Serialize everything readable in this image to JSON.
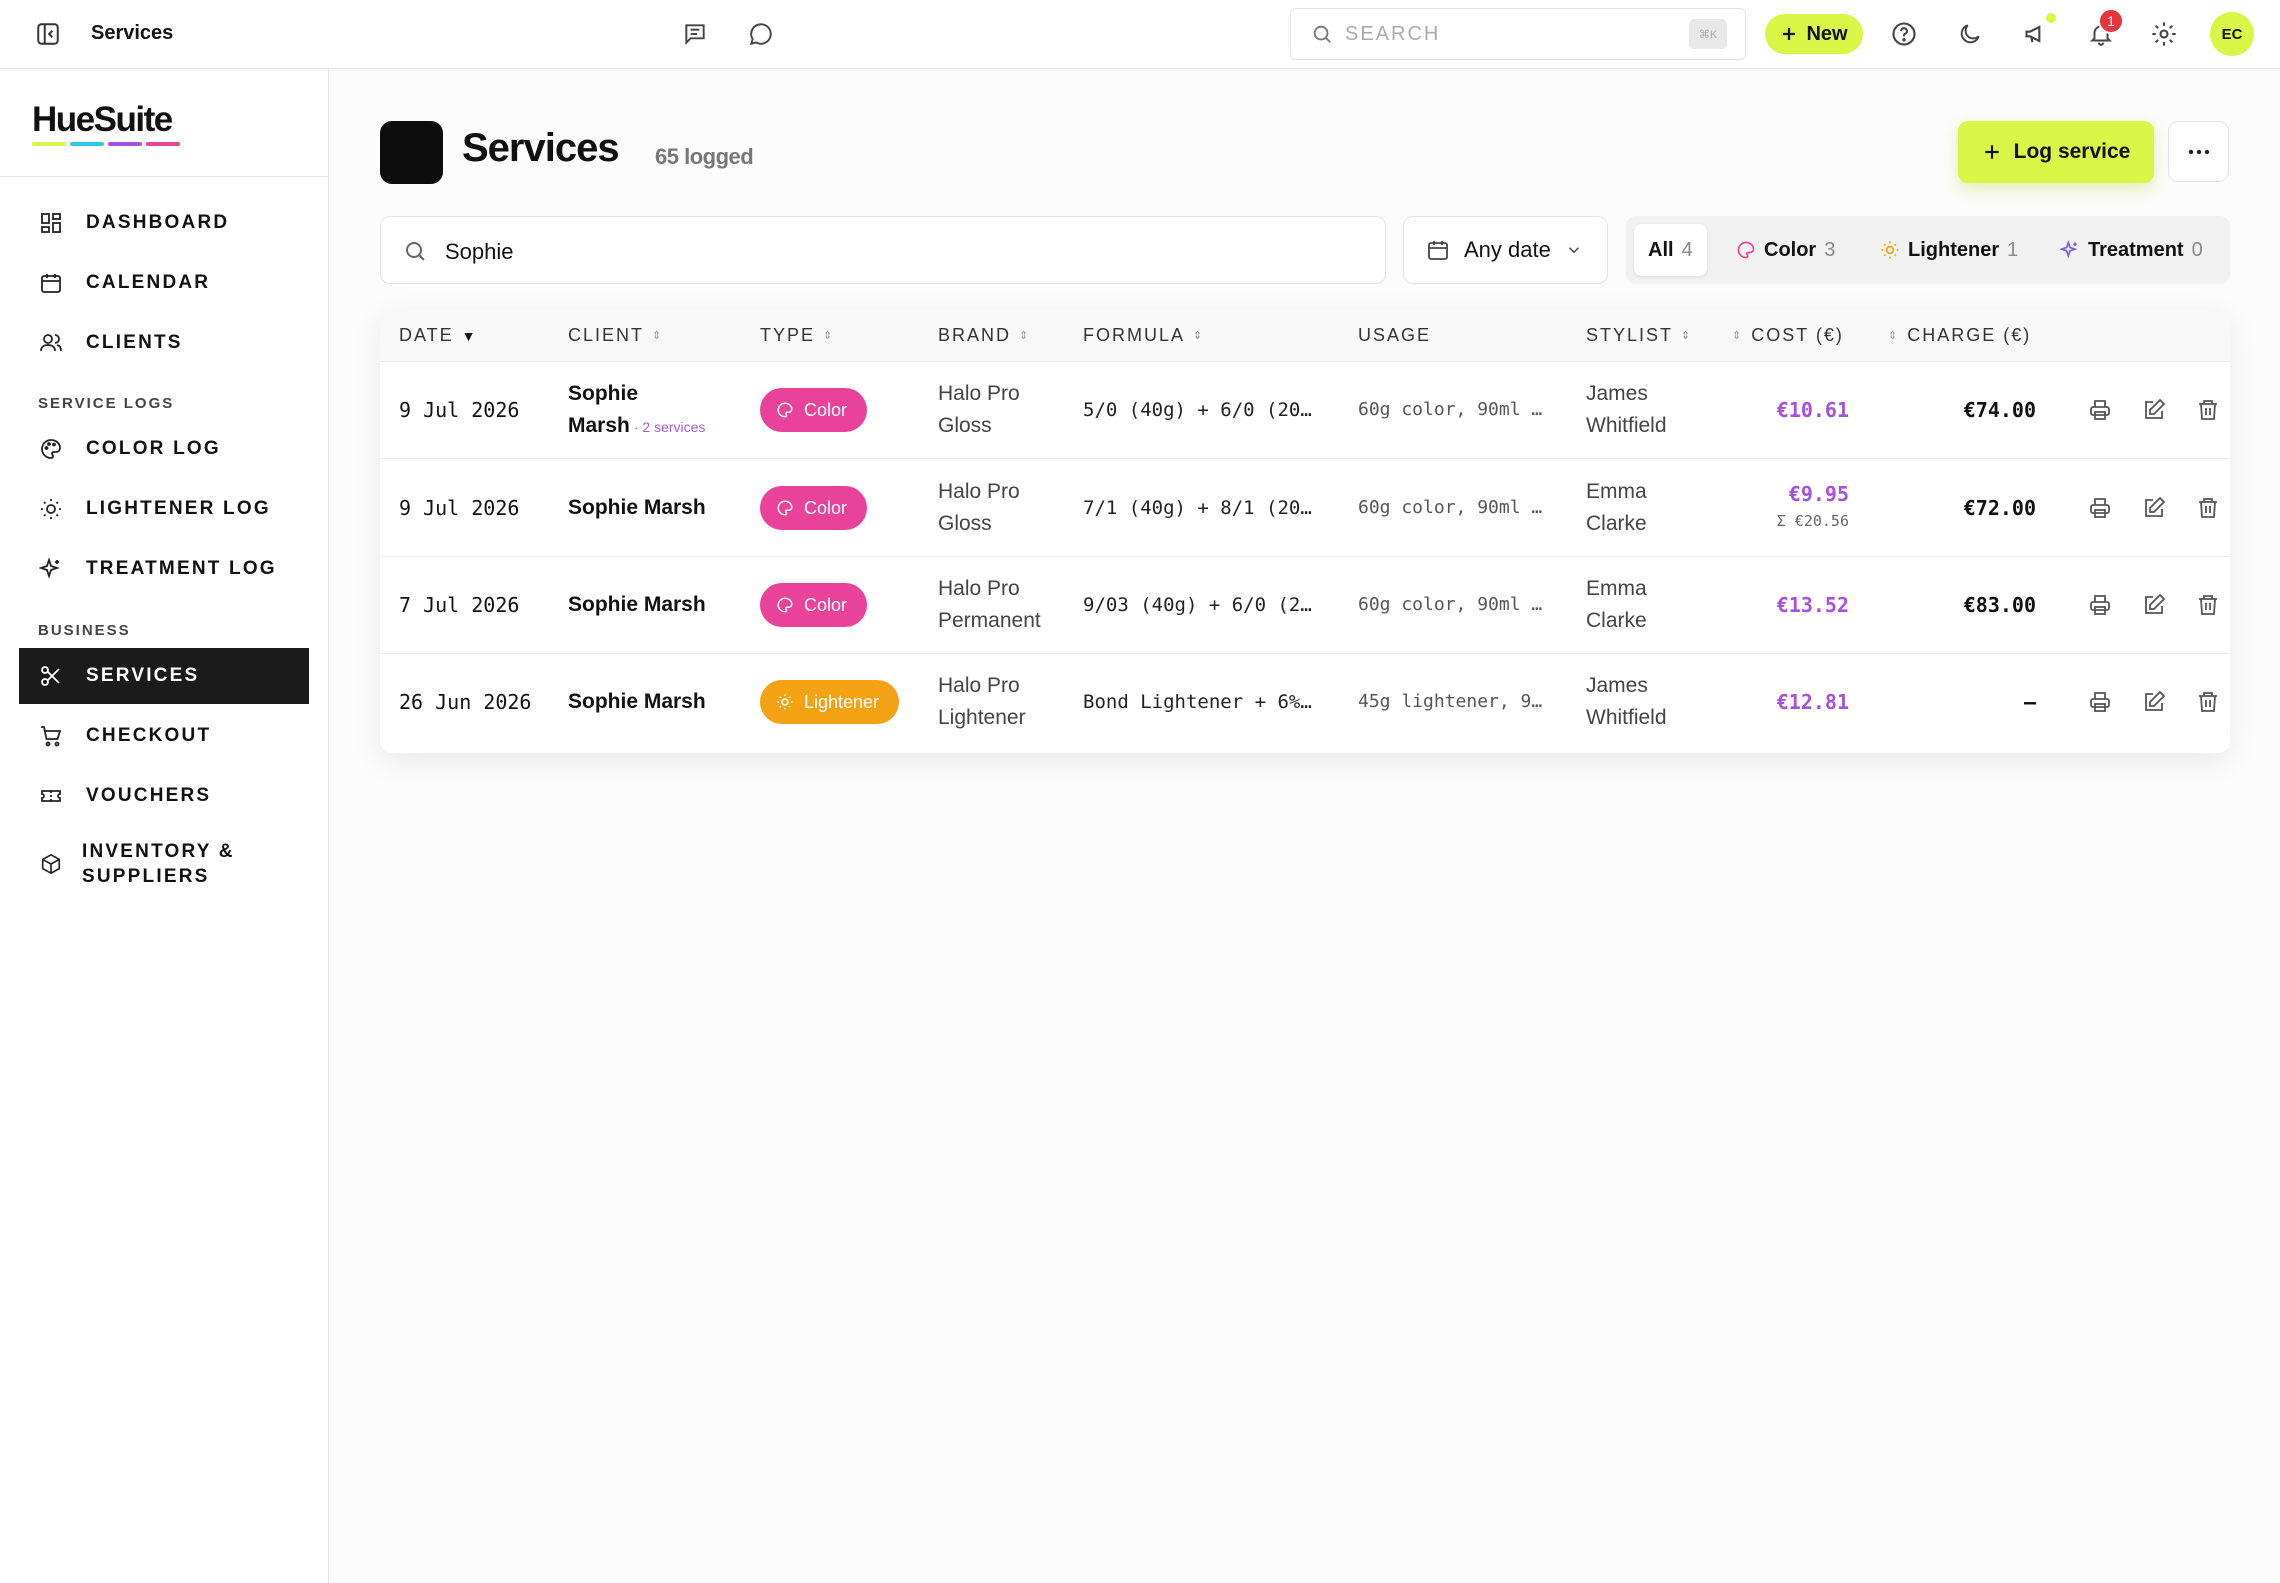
{
  "topbar": {
    "breadcrumb": "Services",
    "search_placeholder": "SEARCH",
    "search_shortcut": "⌘K",
    "new_label": "New",
    "notification_count": "1",
    "avatar_initials": "EC"
  },
  "sidebar": {
    "logo": "HueSuite",
    "logo_colors": [
      "#d9f546",
      "#2fc6e8",
      "#a650e0",
      "#e8429a"
    ],
    "items": [
      {
        "label": "DASHBOARD",
        "icon": "grid-icon"
      },
      {
        "label": "CALENDAR",
        "icon": "calendar-icon"
      },
      {
        "label": "CLIENTS",
        "icon": "users-icon"
      }
    ],
    "section_service_logs": "SERVICE LOGS",
    "log_items": [
      {
        "label": "COLOR LOG",
        "icon": "palette-icon"
      },
      {
        "label": "LIGHTENER LOG",
        "icon": "sun-icon"
      },
      {
        "label": "TREATMENT LOG",
        "icon": "sparkles-icon"
      }
    ],
    "section_business": "BUSINESS",
    "business_items": [
      {
        "label": "SERVICES",
        "icon": "scissors-icon",
        "active": true
      },
      {
        "label": "CHECKOUT",
        "icon": "cart-icon"
      },
      {
        "label": "VOUCHERS",
        "icon": "ticket-icon"
      },
      {
        "label": "INVENTORY &",
        "label2": "SUPPLIERS",
        "icon": "box-icon"
      }
    ]
  },
  "main": {
    "title": "Services",
    "count": "65 logged",
    "log_button": "Log service",
    "filter": {
      "search_value": "Sophie",
      "date_label": "Any date",
      "tabs": [
        {
          "label": "All",
          "count": "4",
          "active": true
        },
        {
          "label": "Color",
          "count": "3"
        },
        {
          "label": "Lightener",
          "count": "1"
        },
        {
          "label": "Treatment",
          "count": "0"
        }
      ]
    },
    "table": {
      "headers": {
        "date": "DATE",
        "client": "CLIENT",
        "type": "TYPE",
        "brand": "BRAND",
        "formula": "FORMULA",
        "usage": "USAGE",
        "stylist": "STYLIST",
        "cost": "COST (€)",
        "charge": "CHARGE (€)"
      },
      "rows": [
        {
          "date": "9 Jul 2026",
          "client": "Sophie",
          "client2": "Marsh",
          "client_sub": "· 2 services",
          "type": "Color",
          "brand1": "Halo Pro",
          "brand2": "Gloss",
          "formula": "5/0 (40g) + 6/0 (20…",
          "usage": "60g color, 90ml …",
          "stylist1": "James",
          "stylist2": "Whitfield",
          "cost": "€10.61",
          "cost_sum": "",
          "charge": "€74.00"
        },
        {
          "date": "9 Jul 2026",
          "client": "Sophie Marsh",
          "type": "Color",
          "brand1": "Halo Pro",
          "brand2": "Gloss",
          "formula": "7/1 (40g) + 8/1 (20…",
          "usage": "60g color, 90ml …",
          "stylist1": "Emma",
          "stylist2": "Clarke",
          "cost": "€9.95",
          "cost_sum": "Σ €20.56",
          "charge": "€72.00"
        },
        {
          "date": "7 Jul 2026",
          "client": "Sophie Marsh",
          "type": "Color",
          "brand1": "Halo Pro",
          "brand2": "Permanent",
          "formula": "9/03 (40g) + 6/0 (2…",
          "usage": "60g color, 90ml …",
          "stylist1": "Emma",
          "stylist2": "Clarke",
          "cost": "€13.52",
          "cost_sum": "",
          "charge": "€83.00"
        },
        {
          "date": "26 Jun 2026",
          "client": "Sophie Marsh",
          "type": "Lightener",
          "brand1": "Halo Pro",
          "brand2": "Lightener",
          "formula": "Bond Lightener + 6%…",
          "usage": "45g lightener, 9…",
          "stylist1": "James",
          "stylist2": "Whitfield",
          "cost": "€12.81",
          "cost_sum": "",
          "charge": "–"
        }
      ]
    }
  },
  "colors": {
    "accent": "#d9f546",
    "color_pill": "#e8429a",
    "lightener_pill": "#f2a213",
    "cost_text": "#a650e0"
  }
}
